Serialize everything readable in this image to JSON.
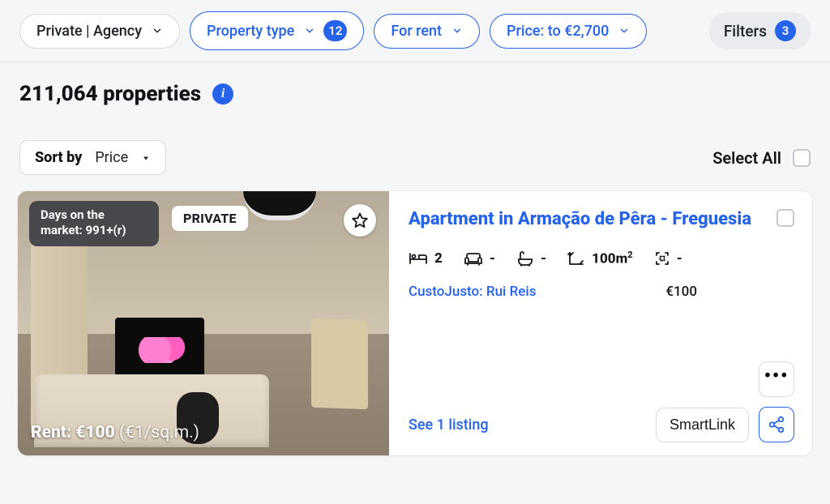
{
  "filters": {
    "agency": "Private | Agency",
    "property_type": {
      "label": "Property type",
      "count": "12"
    },
    "tenure": "For rent",
    "price": "Price: to €2,700",
    "more": {
      "label": "Filters",
      "count": "3"
    }
  },
  "results": {
    "count_line": "211,064 properties"
  },
  "sort": {
    "label": "Sort by",
    "value": "Price"
  },
  "select_all": "Select All",
  "listing": {
    "days_on_market": "Days on the market: 991+(r)",
    "badge_private": "PRIVATE",
    "rent_label": "Rent: €100",
    "rent_per_unit": "(€1/sq.m.)",
    "title": "Apartment in Armação de Pêra - Freguesia",
    "specs": {
      "beds": "2",
      "sofa": "-",
      "bath": "-",
      "area_value": "100m",
      "area_sup": "2",
      "plot": "-"
    },
    "source": "CustoJusto: Rui Reis",
    "price": "€100",
    "see_listing": "See 1 listing",
    "smartlink": "SmartLink"
  }
}
